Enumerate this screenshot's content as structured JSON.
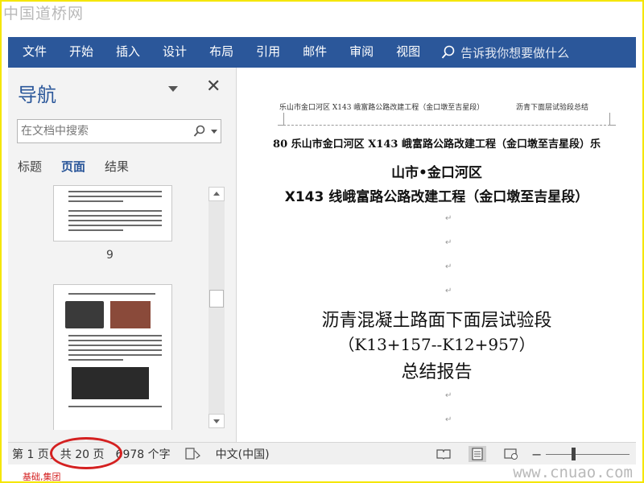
{
  "watermark": {
    "top": "中国道桥网",
    "bottom": "www.cnuao.com"
  },
  "ribbon": {
    "tabs": [
      "文件",
      "开始",
      "插入",
      "设计",
      "布局",
      "引用",
      "邮件",
      "审阅",
      "视图"
    ],
    "tell_me": "告诉我你想要做什么",
    "color": "#2b579a"
  },
  "nav": {
    "title": "导航",
    "search_placeholder": "在文档中搜索",
    "tabs": [
      "标题",
      "页面",
      "结果"
    ],
    "active_tab": "页面",
    "thumbnails": [
      {
        "page": "9"
      },
      {
        "page": ""
      }
    ]
  },
  "document": {
    "header_left": "乐山市金口河区 X143 峨富路公路改建工程（金口墩至吉星段）",
    "header_right": "沥青下面层试验段总结",
    "title_line1": "80 乐山市金口河区 X143 峨富路公路改建工程（金口墩至吉星段）乐",
    "title_line2": "山市•金口河区",
    "title_line3": "X143 线峨富路公路改建工程（金口墩至吉星段）",
    "main_line1": "沥青混凝土路面下面层试验段",
    "main_line2": "（K13+157--K12+957）",
    "main_line3": "总结报告"
  },
  "status_bar": {
    "page": "第 1 页，共 20 页",
    "words": "6978 个字",
    "language": "中文(中国)",
    "accent": "#d42020"
  },
  "annotation": {
    "fragment": "基础,集团"
  }
}
